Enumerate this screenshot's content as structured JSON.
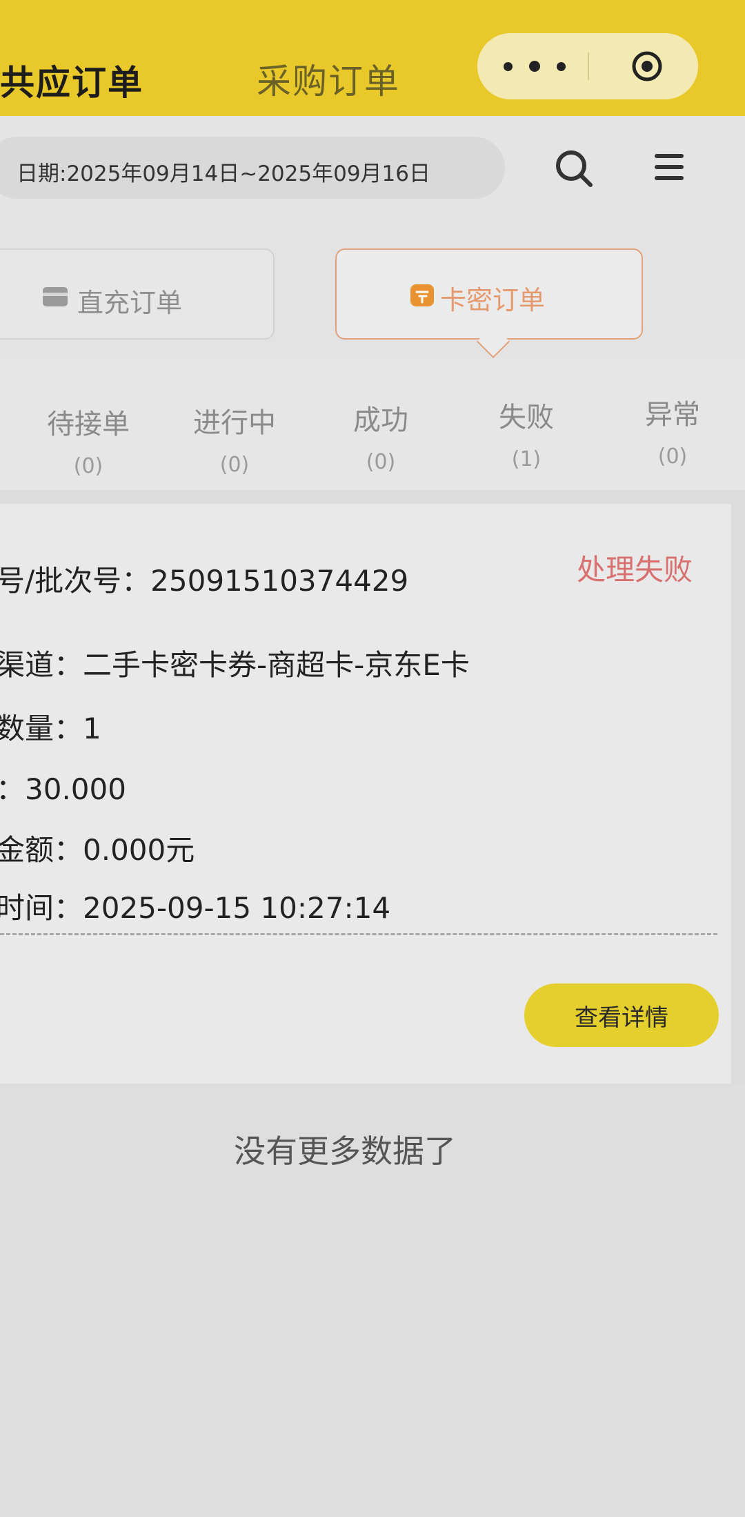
{
  "header": {
    "tab_supply": "供应订单",
    "tab_supply_visible": "共应订单",
    "tab_purchase": "采购订单",
    "capsule_more_icon": "more-dots-icon",
    "capsule_close_icon": "target-circle-icon"
  },
  "filter": {
    "date_range": "日期:2025年09月14日~2025年09月16日",
    "search_icon": "search-icon",
    "menu_icon": "menu-icon"
  },
  "order_types": {
    "direct": "直充订单",
    "card": "卡密订单",
    "active": "card"
  },
  "status_tabs": [
    {
      "name": "待接单",
      "count": "(0)"
    },
    {
      "name": "进行中",
      "count": "(0)"
    },
    {
      "name": "成功",
      "count": "(0)"
    },
    {
      "name": "失败",
      "count": "(1)"
    },
    {
      "name": "异常",
      "count": "(0)"
    }
  ],
  "order": {
    "batch_line": "号/批次号：25091510374429",
    "status": "处理失败",
    "channel_line": "渠道：二手卡密卡券-商超卡-京东E卡",
    "quantity_line": "数量：1",
    "price_line": "：30.000",
    "amount_line": "金额：0.000元",
    "time_line": "时间：2025-09-15 10:27:14",
    "detail_button": "查看详情"
  },
  "footer": {
    "no_more": "没有更多数据了"
  },
  "colors": {
    "header_bg": "#e9c82a",
    "accent_orange": "#e49a6e",
    "fail_red": "#d87070",
    "button_yellow": "#e4cf2d"
  }
}
